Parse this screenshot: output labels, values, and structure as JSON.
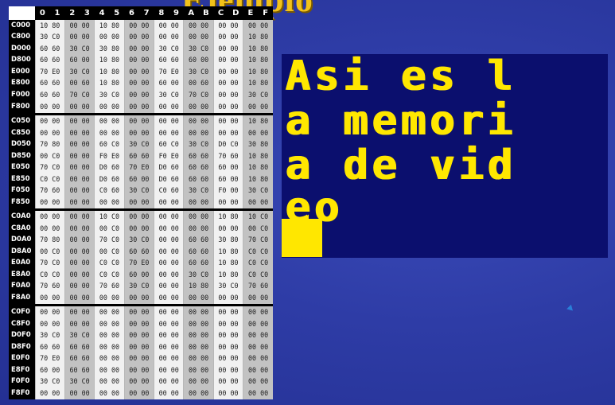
{
  "title": "Ejemplo",
  "memory_table": {
    "columns": [
      "0",
      "1",
      "2",
      "3",
      "4",
      "5",
      "6",
      "7",
      "8",
      "9",
      "A",
      "B",
      "C",
      "D",
      "E",
      "F"
    ],
    "blocks": [
      {
        "rows": [
          {
            "addr": "C000",
            "cells": [
              "10 80",
              "00 00",
              "10 80",
              "00 00",
              "00 00",
              "00 00",
              "00 00",
              "00 00"
            ]
          },
          {
            "addr": "C800",
            "cells": [
              "30 C0",
              "00 00",
              "00 00",
              "00 00",
              "00 00",
              "00 00",
              "00 00",
              "10 80"
            ]
          },
          {
            "addr": "D000",
            "cells": [
              "60 60",
              "30 C0",
              "30 80",
              "00 00",
              "30 C0",
              "30 C0",
              "00 00",
              "10 80"
            ]
          },
          {
            "addr": "D800",
            "cells": [
              "60 60",
              "60 00",
              "10 80",
              "00 00",
              "60 60",
              "60 00",
              "00 00",
              "10 80"
            ]
          },
          {
            "addr": "E000",
            "cells": [
              "70 E0",
              "30 C0",
              "10 80",
              "00 00",
              "70 E0",
              "30 C0",
              "00 00",
              "10 80"
            ]
          },
          {
            "addr": "E800",
            "cells": [
              "60 60",
              "00 60",
              "10 80",
              "00 00",
              "60 00",
              "00 60",
              "00 00",
              "10 80"
            ]
          },
          {
            "addr": "F000",
            "cells": [
              "60 60",
              "70 C0",
              "30 C0",
              "00 00",
              "30 C0",
              "70 C0",
              "00 00",
              "30 C0"
            ]
          },
          {
            "addr": "F800",
            "cells": [
              "00 00",
              "00 00",
              "00 00",
              "00 00",
              "00 00",
              "00 00",
              "00 00",
              "00 00"
            ]
          }
        ]
      },
      {
        "rows": [
          {
            "addr": "C050",
            "cells": [
              "00 00",
              "00 00",
              "00 00",
              "00 00",
              "00 00",
              "00 00",
              "00 00",
              "10 80"
            ]
          },
          {
            "addr": "C850",
            "cells": [
              "00 00",
              "00 00",
              "00 00",
              "00 00",
              "00 00",
              "00 00",
              "00 00",
              "00 00"
            ]
          },
          {
            "addr": "D050",
            "cells": [
              "70 80",
              "00 00",
              "60 C0",
              "30 C0",
              "60 C0",
              "30 C0",
              "D0 C0",
              "30 80"
            ]
          },
          {
            "addr": "D850",
            "cells": [
              "00 C0",
              "00 00",
              "F0 E0",
              "60 60",
              "F0 E0",
              "60 60",
              "70 60",
              "10 80"
            ]
          },
          {
            "addr": "E050",
            "cells": [
              "70 C0",
              "00 00",
              "D0 60",
              "70 E0",
              "D0 60",
              "60 60",
              "60 00",
              "10 80"
            ]
          },
          {
            "addr": "E850",
            "cells": [
              "C0 C0",
              "00 00",
              "D0 60",
              "60 00",
              "D0 60",
              "60 60",
              "60 00",
              "10 80"
            ]
          },
          {
            "addr": "F050",
            "cells": [
              "70 60",
              "00 00",
              "C0 60",
              "30 C0",
              "C0 60",
              "30 C0",
              "F0 00",
              "30 C0"
            ]
          },
          {
            "addr": "F850",
            "cells": [
              "00 00",
              "00 00",
              "00 00",
              "00 00",
              "00 00",
              "00 00",
              "00 00",
              "00 00"
            ]
          }
        ]
      },
      {
        "rows": [
          {
            "addr": "C0A0",
            "cells": [
              "00 00",
              "00 00",
              "10 C0",
              "00 00",
              "00 00",
              "00 00",
              "10 80",
              "10 C0"
            ]
          },
          {
            "addr": "C8A0",
            "cells": [
              "00 00",
              "00 00",
              "00 C0",
              "00 00",
              "00 00",
              "00 00",
              "00 00",
              "00 C0"
            ]
          },
          {
            "addr": "D0A0",
            "cells": [
              "70 80",
              "00 00",
              "70 C0",
              "30 C0",
              "00 00",
              "60 60",
              "30 80",
              "70 C0"
            ]
          },
          {
            "addr": "D8A0",
            "cells": [
              "00 C0",
              "00 00",
              "00 C0",
              "60 60",
              "00 00",
              "60 60",
              "10 80",
              "C0 C0"
            ]
          },
          {
            "addr": "E0A0",
            "cells": [
              "70 C0",
              "00 00",
              "C0 C0",
              "70 E0",
              "00 00",
              "60 60",
              "10 80",
              "C0 C0"
            ]
          },
          {
            "addr": "E8A0",
            "cells": [
              "C0 C0",
              "00 00",
              "C0 C0",
              "60 00",
              "00 00",
              "30 C0",
              "10 80",
              "C0 C0"
            ]
          },
          {
            "addr": "F0A0",
            "cells": [
              "70 60",
              "00 00",
              "70 60",
              "30 C0",
              "00 00",
              "10 80",
              "30 C0",
              "70 60"
            ]
          },
          {
            "addr": "F8A0",
            "cells": [
              "00 00",
              "00 00",
              "00 00",
              "00 00",
              "00 00",
              "00 00",
              "00 00",
              "00 00"
            ]
          }
        ]
      },
      {
        "rows": [
          {
            "addr": "C0F0",
            "cells": [
              "00 00",
              "00 00",
              "00 00",
              "00 00",
              "00 00",
              "00 00",
              "00 00",
              "00 00"
            ]
          },
          {
            "addr": "C8F0",
            "cells": [
              "00 00",
              "00 00",
              "00 00",
              "00 00",
              "00 00",
              "00 00",
              "00 00",
              "00 00"
            ]
          },
          {
            "addr": "D0F0",
            "cells": [
              "30 C0",
              "30 C0",
              "00 00",
              "00 00",
              "00 00",
              "00 00",
              "00 00",
              "00 00"
            ]
          },
          {
            "addr": "D8F0",
            "cells": [
              "60 60",
              "60 60",
              "00 00",
              "00 00",
              "00 00",
              "00 00",
              "00 00",
              "00 00"
            ]
          },
          {
            "addr": "E0F0",
            "cells": [
              "70 E0",
              "60 60",
              "00 00",
              "00 00",
              "00 00",
              "00 00",
              "00 00",
              "00 00"
            ]
          },
          {
            "addr": "E8F0",
            "cells": [
              "60 00",
              "60 60",
              "00 00",
              "00 00",
              "00 00",
              "00 00",
              "00 00",
              "00 00"
            ]
          },
          {
            "addr": "F0F0",
            "cells": [
              "30 C0",
              "30 C0",
              "00 00",
              "00 00",
              "00 00",
              "00 00",
              "00 00",
              "00 00"
            ]
          },
          {
            "addr": "F8F0",
            "cells": [
              "00 00",
              "00 00",
              "00 00",
              "00 00",
              "00 00",
              "00 00",
              "00 00",
              "00 00"
            ]
          }
        ]
      }
    ]
  },
  "screen": {
    "lines": [
      "Asi es l",
      "a memori",
      "a de vid",
      "eo"
    ],
    "text_color": "#ffe700",
    "background_color": "#0b0f6e"
  },
  "colors": {
    "slide_background": "#2e3ca6",
    "title": "#f2c21a"
  },
  "icons": {
    "mouse": "mouse-pointer-icon"
  }
}
